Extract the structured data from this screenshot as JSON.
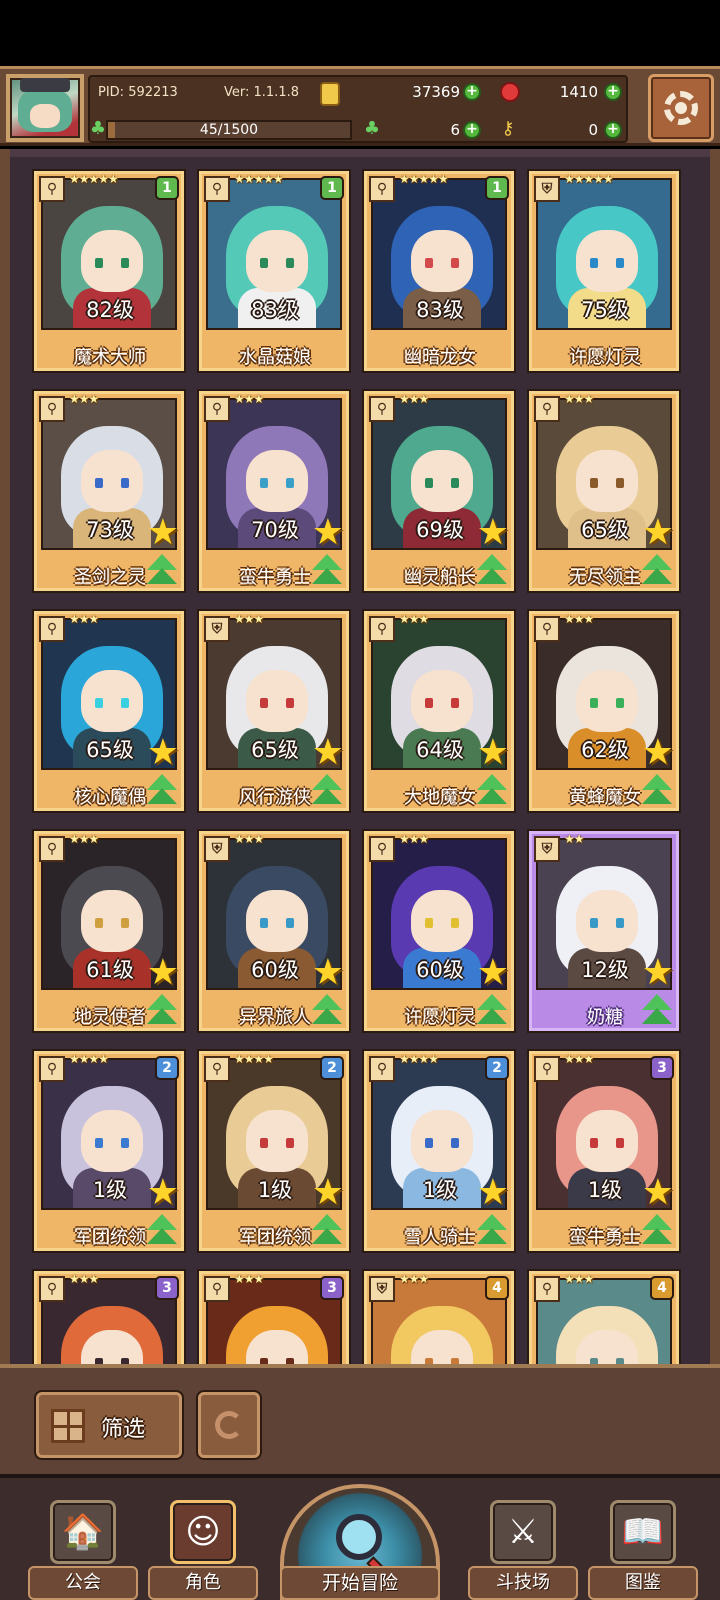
{
  "header": {
    "pid": "PID: 592213",
    "version": "Ver: 1.1.1.8",
    "coins": "37369",
    "gems": "1410",
    "stamina": "45/1500",
    "stamina_fraction": 0.03,
    "clovers": "6",
    "keys": "0"
  },
  "cards": [
    {
      "level": "82级",
      "name": "魔术大师",
      "stars": "★★★★★",
      "rank": "1",
      "rank_class": "r1",
      "type": "key",
      "star_badge": false,
      "hair": "#5fae93",
      "bg": "#4a4540",
      "body": "#b2333a",
      "eye": "#2a8a5a"
    },
    {
      "level": "83级",
      "name": "水晶菇娘",
      "stars": "★★★★★",
      "rank": "1",
      "rank_class": "r1",
      "type": "key",
      "star_badge": false,
      "hair": "#55c9b8",
      "bg": "#3a6e8c",
      "body": "#f0f0f0",
      "eye": "#2a8a5a"
    },
    {
      "level": "83级",
      "name": "幽暗龙女",
      "stars": "★★★★★",
      "rank": "1",
      "rank_class": "r1",
      "type": "key",
      "star_badge": false,
      "hair": "#2f63b5",
      "bg": "#1f2f52",
      "body": "#7b5e48",
      "eye": "#d24a4a"
    },
    {
      "level": "75级",
      "name": "许愿灯灵",
      "stars": "★★★★★",
      "rank": "",
      "rank_class": "",
      "type": "shield",
      "star_badge": false,
      "hair": "#48c7c7",
      "bg": "#356b8e",
      "body": "#f2dc8a",
      "eye": "#2a8ac7"
    },
    {
      "level": "73级",
      "name": "圣剑之灵",
      "stars": "★★★",
      "rank": "",
      "rank_class": "",
      "type": "key",
      "star_badge": true,
      "hair": "#d8dde6",
      "bg": "#5a4e46",
      "body": "#d9b57a",
      "eye": "#3a6ac7"
    },
    {
      "level": "70级",
      "name": "蛮牛勇士",
      "stars": "★★★",
      "rank": "",
      "rank_class": "",
      "type": "key",
      "star_badge": true,
      "hair": "#8f78b8",
      "bg": "#3c3556",
      "body": "#5b4a7a",
      "eye": "#3aa0c7"
    },
    {
      "level": "69级",
      "name": "幽灵船长",
      "stars": "★★★",
      "rank": "",
      "rank_class": "",
      "type": "key",
      "star_badge": true,
      "hair": "#4ea98e",
      "bg": "#2c3b45",
      "body": "#8e2a35",
      "eye": "#2a8a5a"
    },
    {
      "level": "65级",
      "name": "无尽领主",
      "stars": "★★★",
      "rank": "",
      "rank_class": "",
      "type": "key",
      "star_badge": true,
      "hair": "#e9cc95",
      "bg": "#5a4a3a",
      "body": "#e0c08a",
      "eye": "#8a5a2a"
    },
    {
      "level": "65级",
      "name": "核心魔偶",
      "stars": "★★★",
      "rank": "",
      "rank_class": "",
      "type": "key",
      "star_badge": true,
      "hair": "#2aa6d8",
      "bg": "#1f3550",
      "body": "#2b4a5a",
      "eye": "#3ad0e0"
    },
    {
      "level": "65级",
      "name": "风行游侠",
      "stars": "★★★",
      "rank": "",
      "rank_class": "",
      "type": "shield",
      "star_badge": true,
      "hair": "#e8e8ea",
      "bg": "#4a3a30",
      "body": "#3b5a48",
      "eye": "#c73a3a"
    },
    {
      "level": "64级",
      "name": "大地魔女",
      "stars": "★★★",
      "rank": "",
      "rank_class": "",
      "type": "key",
      "star_badge": true,
      "hair": "#e0dce4",
      "bg": "#2a4230",
      "body": "#4a7a52",
      "eye": "#c73a3a"
    },
    {
      "level": "62级",
      "name": "黄蜂魔女",
      "stars": "★★★",
      "rank": "",
      "rank_class": "",
      "type": "key",
      "star_badge": true,
      "hair": "#eae4dc",
      "bg": "#3a2c28",
      "body": "#d98e2a",
      "eye": "#3ab05a"
    },
    {
      "level": "61级",
      "name": "地灵使者",
      "stars": "★★★",
      "rank": "",
      "rank_class": "",
      "type": "key",
      "star_badge": true,
      "hair": "#4a4a50",
      "bg": "#2a2428",
      "body": "#a8322a",
      "eye": "#d0a040"
    },
    {
      "level": "60级",
      "name": "异界旅人",
      "stars": "★★★",
      "rank": "",
      "rank_class": "",
      "type": "shield",
      "star_badge": true,
      "hair": "#3a4a62",
      "bg": "#2c3238",
      "body": "#8a5a32",
      "eye": "#3a9ac7"
    },
    {
      "level": "60级",
      "name": "许愿灯灵",
      "stars": "★★★",
      "rank": "",
      "rank_class": "",
      "type": "key",
      "star_badge": true,
      "hair": "#5a3ab0",
      "bg": "#241e48",
      "body": "#3a7ad0",
      "eye": "#e0c030"
    },
    {
      "level": "12级",
      "name": "奶糖",
      "stars": "★★",
      "rank": "",
      "rank_class": "",
      "type": "shield",
      "star_badge": true,
      "purple": true,
      "hair": "#eef0f6",
      "bg": "#4a4250",
      "body": "#5a4a42",
      "eye": "#3a9ac7"
    },
    {
      "level": "1级",
      "name": "军团统领",
      "stars": "★★★★",
      "rank": "2",
      "rank_class": "r2",
      "type": "key",
      "star_badge": true,
      "hair": "#c9c2dc",
      "bg": "#3a3048",
      "body": "#5a4a6a",
      "eye": "#3a7ad0"
    },
    {
      "level": "1级",
      "name": "军团统领",
      "stars": "★★★★",
      "rank": "2",
      "rank_class": "r2",
      "type": "key",
      "star_badge": true,
      "hair": "#e9cc95",
      "bg": "#4a3828",
      "body": "#6a4a32",
      "eye": "#c73a3a"
    },
    {
      "level": "1级",
      "name": "雪人骑士",
      "stars": "★★★★",
      "rank": "2",
      "rank_class": "r2",
      "type": "key",
      "star_badge": true,
      "hair": "#e8eef8",
      "bg": "#2c3a52",
      "body": "#8ab8e0",
      "eye": "#3a6ac7"
    },
    {
      "level": "1级",
      "name": "蛮牛勇士",
      "stars": "★★★",
      "rank": "3",
      "rank_class": "r3",
      "type": "key",
      "star_badge": true,
      "hair": "#e8968a",
      "bg": "#4a3030",
      "body": "#3a3a48",
      "eye": "#c73a3a"
    },
    {
      "level": "",
      "name": "",
      "stars": "★★★",
      "rank": "3",
      "rank_class": "r3",
      "type": "key",
      "star_badge": false,
      "hair": "#e06a3a",
      "bg": "#3a2830",
      "body": "#3a2830",
      "eye": "#3a2830"
    },
    {
      "level": "",
      "name": "",
      "stars": "★★★",
      "rank": "3",
      "rank_class": "r3",
      "type": "key",
      "star_badge": false,
      "hair": "#f0a030",
      "bg": "#6a2a1a",
      "body": "#6a2a1a",
      "eye": "#6a2a1a"
    },
    {
      "level": "",
      "name": "",
      "stars": "★★★",
      "rank": "4",
      "rank_class": "r4",
      "type": "shield",
      "star_badge": false,
      "hair": "#f2c860",
      "bg": "#c87a3a",
      "body": "#c87a3a",
      "eye": "#c87a3a"
    },
    {
      "level": "",
      "name": "",
      "stars": "★★★",
      "rank": "4",
      "rank_class": "r4",
      "type": "key",
      "star_badge": false,
      "hair": "#f4e0b8",
      "bg": "#5a8a8a",
      "body": "#5a8a8a",
      "eye": "#5a8a8a"
    }
  ],
  "filter": {
    "label": "筛选"
  },
  "nav": {
    "guild": "公会",
    "character": "角色",
    "adventure": "开始冒险",
    "arena": "斗技场",
    "codex": "图鉴"
  }
}
